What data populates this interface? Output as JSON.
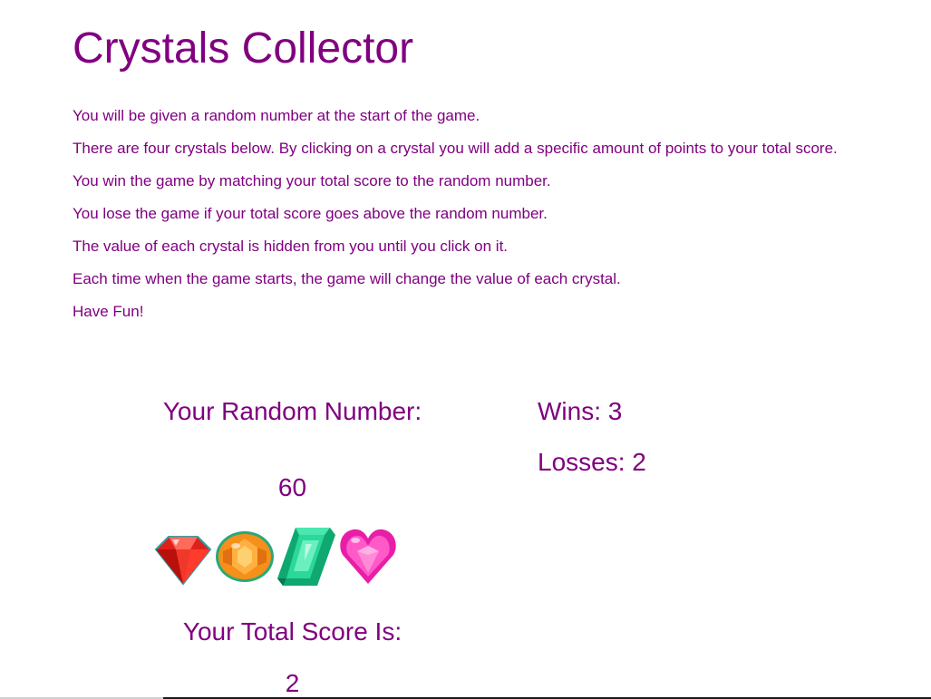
{
  "title": "Crystals Collector",
  "instructions": [
    "You will be given a random number at the start of the game.",
    "There are four crystals below. By clicking on a crystal you will add a specific amount of points to your total score.",
    "You win the game by matching your total score to the random number.",
    "You lose the game if your total score goes above the random number.",
    "The value of each crystal is hidden from you until you click on it.",
    "Each time when the game starts, the game will change the value of each crystal.",
    "Have Fun!"
  ],
  "random_number": {
    "label": "Your Random Number:",
    "value": "60"
  },
  "stats": {
    "wins": "Wins: 3",
    "losses": "Losses: 2"
  },
  "crystals": [
    {
      "icon": "red-diamond-crystal-icon",
      "color": "#e0201a"
    },
    {
      "icon": "orange-round-crystal-icon",
      "color": "#f5901a"
    },
    {
      "icon": "green-emerald-crystal-icon",
      "color": "#1ec98a"
    },
    {
      "icon": "pink-heart-crystal-icon",
      "color": "#e81ea8"
    }
  ],
  "total_score": {
    "label": "Your Total Score Is:",
    "value": "2"
  },
  "colors": {
    "text": "#800080",
    "background": "#ffffff"
  }
}
